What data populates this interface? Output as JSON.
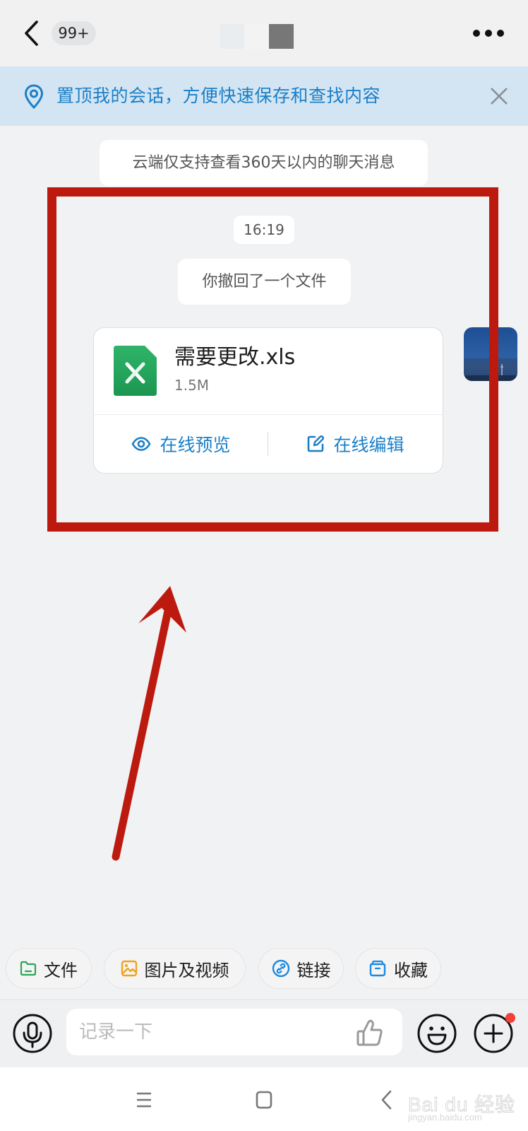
{
  "header": {
    "unread_badge": "99+",
    "title_redacted": true
  },
  "banner": {
    "text": "置顶我的会话，方便快速保存和查找内容",
    "accent_color": "#1b7fc8"
  },
  "chat": {
    "notice": "云端仅支持查看360天以内的聊天消息",
    "timestamp": "16:19",
    "recall_notice": "你撤回了一个文件",
    "file_message": {
      "file_name": "需要更改.xls",
      "file_size": "1.5M",
      "file_type_icon": "excel-icon",
      "actions": [
        {
          "label": "在线预览",
          "icon": "eye-icon"
        },
        {
          "label": "在线编辑",
          "icon": "edit-icon"
        }
      ]
    }
  },
  "annotation": {
    "highlight_color": "#bd1a0f",
    "shapes": [
      "highlight-box",
      "pointer-arrow"
    ]
  },
  "quick_chips": [
    {
      "label": "文件",
      "icon": "folder-icon",
      "color": "#2ca55a"
    },
    {
      "label": "图片及视频",
      "icon": "image-icon",
      "color": "#f0a21e"
    },
    {
      "label": "链接",
      "icon": "link-icon",
      "color": "#1d8ae0"
    },
    {
      "label": "收藏",
      "icon": "favorites-box-icon",
      "color": "#1d8ae0"
    }
  ],
  "composer": {
    "placeholder": "记录一下",
    "value": ""
  },
  "watermark": {
    "main": "Bai du 经验",
    "sub": "jingyan.baidu.com"
  }
}
